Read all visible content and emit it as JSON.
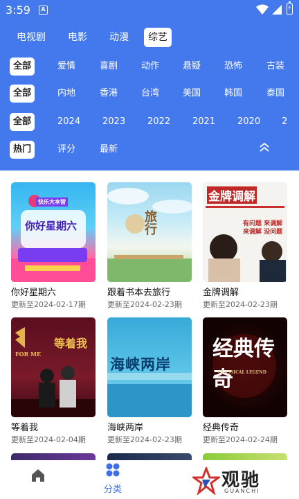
{
  "status_bar": {
    "time": "3:59",
    "notif_icon": "A"
  },
  "category_tabs": [
    {
      "label": "电视剧",
      "active": false
    },
    {
      "label": "电影",
      "active": false
    },
    {
      "label": "动漫",
      "active": false
    },
    {
      "label": "综艺",
      "active": true
    }
  ],
  "filters": {
    "type": [
      "全部",
      "爱情",
      "喜剧",
      "动作",
      "悬疑",
      "恐怖",
      "古装"
    ],
    "region": [
      "全部",
      "内地",
      "香港",
      "台湾",
      "美国",
      "韩国",
      "泰国"
    ],
    "year": [
      "全部",
      "2024",
      "2023",
      "2022",
      "2021",
      "2020",
      "2"
    ],
    "sort": [
      "热门",
      "评分",
      "最新"
    ]
  },
  "shows": [
    {
      "title": "你好星期六",
      "update": "更新至2024-02-17期",
      "poster_text": "你好星期六",
      "poster_badge": "快乐大本营"
    },
    {
      "title": "跟着书本去旅行",
      "update": "更新至2024-02-23期",
      "poster_text": "旅行"
    },
    {
      "title": "金牌调解",
      "update": "更新至2024-02-23期",
      "poster_text": "金牌调解",
      "poster_sub": "有问题 来调解",
      "poster_sub2": "来调解 没问题"
    },
    {
      "title": "等着我",
      "update": "更新至2024-02-04期",
      "poster_text": "等着我",
      "poster_sub": "FOR ME"
    },
    {
      "title": "海峡两岸",
      "update": "更新至2024-02-23期",
      "poster_text": "海峡两岸"
    },
    {
      "title": "经典传奇",
      "update": "更新至2024-02-24期",
      "poster_text": "经典传奇",
      "poster_sub": "CLASSICAL LEGEND"
    }
  ],
  "bottom_nav": {
    "home_icon": "home-icon",
    "category_label": "分类"
  },
  "watermark": {
    "text": "观驰",
    "sub": "GUANCHI"
  },
  "colors": {
    "header": "#4479ee",
    "accent": "#3f6fe6"
  }
}
